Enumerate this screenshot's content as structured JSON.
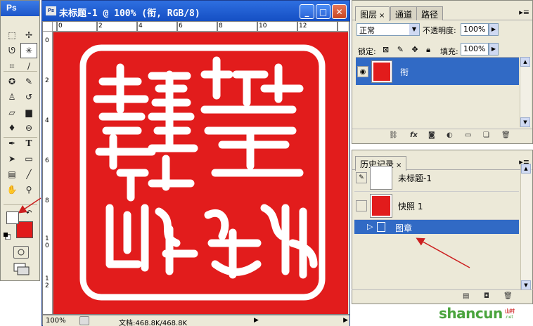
{
  "tools_panel": {
    "app_label": "Ps",
    "colors": {
      "foreground": "#ffffff",
      "background": "#e21c1c"
    }
  },
  "document": {
    "title": "未标题-1 @ 100% (衔, RGB/8)",
    "window_buttons": {
      "minimize": "_",
      "maximize": "□",
      "close": "✕"
    },
    "ruler_top_labels": [
      "0",
      "2",
      "4",
      "6",
      "8",
      "10",
      "12"
    ],
    "ruler_left_labels": [
      "0",
      "2",
      "4",
      "6",
      "8",
      "1\n0",
      "1\n2"
    ],
    "canvas_color": "#e21c1c",
    "status": {
      "zoom": "100%",
      "doc_size": "文档:468.8K/468.8K"
    }
  },
  "layers_panel": {
    "tabs": [
      {
        "label": "图层",
        "close": "×"
      },
      {
        "label": "通道"
      },
      {
        "label": "路径"
      }
    ],
    "blend_mode": "正常",
    "opacity_label": "不透明度:",
    "opacity_value": "100%",
    "lock_label": "锁定:",
    "fill_label": "填充:",
    "fill_value": "100%",
    "layers": [
      {
        "name": "衔"
      }
    ]
  },
  "history_panel": {
    "tabs": [
      {
        "label": "历史记录",
        "close": "×"
      }
    ],
    "entries": [
      {
        "label": "未标题-1"
      },
      {
        "label": "快照 1"
      }
    ],
    "current_step": "图章"
  },
  "watermark": {
    "main": "shancun",
    "sub_cn": "山村",
    "sub_en": ".net"
  }
}
